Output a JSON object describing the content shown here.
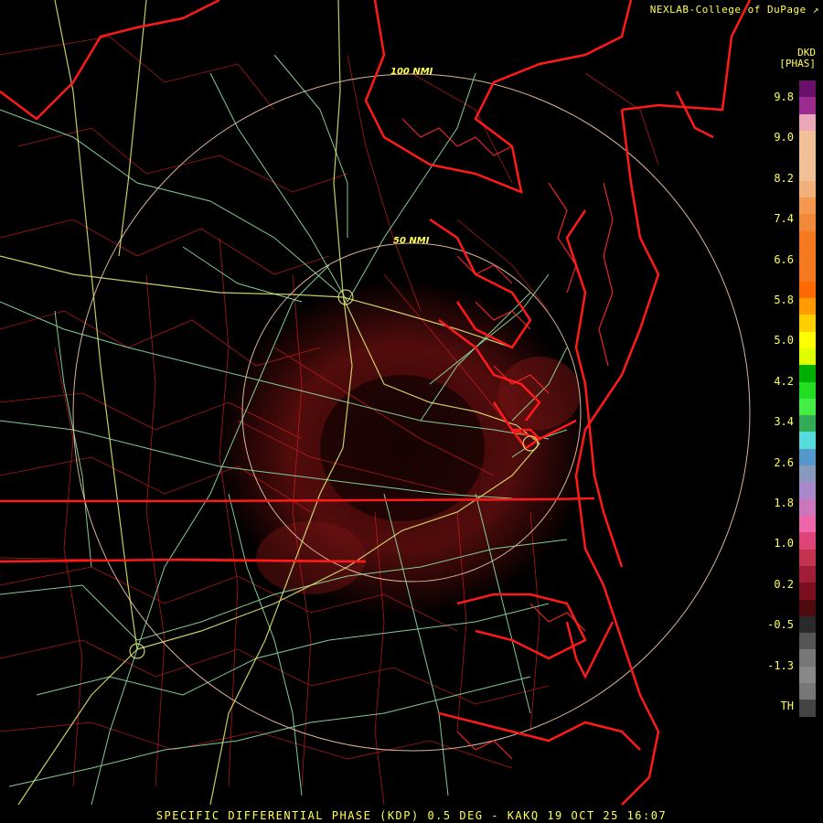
{
  "credit": "NEXLAB-College of DuPage",
  "caption": "SPECIFIC DIFFERENTIAL PHASE (KDP) 0.5 DEG - KAKQ 19 OCT 25 16:07",
  "legend": {
    "title": "DKD",
    "units": "[PHAS]",
    "ticks": [
      "9.8",
      "9.0",
      "8.2",
      "7.4",
      "6.6",
      "5.8",
      "5.0",
      "4.2",
      "3.4",
      "2.6",
      "1.8",
      "1.0",
      "0.2",
      "-0.5",
      "-1.3",
      "TH"
    ],
    "colors": [
      "#6a0f6a",
      "#9b2b8f",
      "#e9a7b8",
      "#f2c096",
      "#f2c096",
      "#f2c096",
      "#f2b07a",
      "#f5984f",
      "#f08a3a",
      "#f57a1f",
      "#f57a1f",
      "#f57a1f",
      "#ff6a00",
      "#ff9a00",
      "#ffd000",
      "#ffff00",
      "#e0ff00",
      "#00b000",
      "#22dd22",
      "#44ee44",
      "#33aa55",
      "#55dddd",
      "#5599cc",
      "#8899bb",
      "#aa88cc",
      "#cc77bb",
      "#ee66aa",
      "#dd4477",
      "#c2334d",
      "#a01d37",
      "#7a0f1f",
      "#4d0a0f",
      "#2a2a2a",
      "#555555",
      "#777777",
      "#888888",
      "#777777",
      "#444444",
      "#000000"
    ]
  },
  "rings": [
    {
      "label": "50 NMI"
    },
    {
      "label": "100 NMI"
    }
  ],
  "colors": {
    "background": "#000000",
    "state_borders": "#ff1a1a",
    "county_lines": "#c81e1e",
    "highways": "#8fe3a3",
    "interstates": "#e6f07a",
    "range_rings": "#f0c8a8",
    "echo": "#6b0f0f"
  },
  "icons": {
    "credit_mark": "external-link-icon"
  }
}
